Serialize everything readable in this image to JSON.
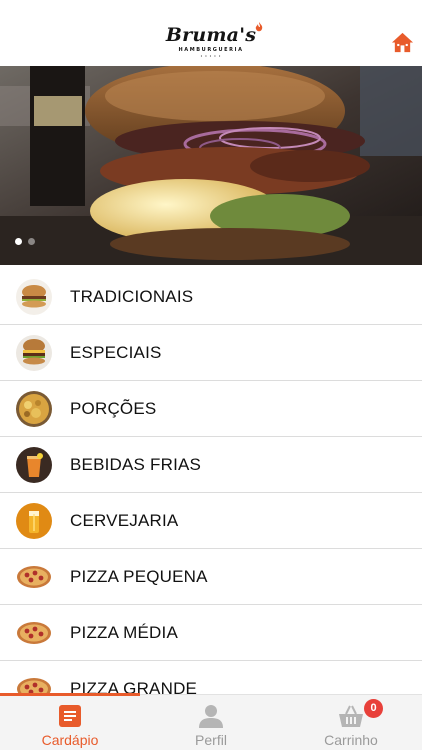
{
  "header": {
    "logo_main": "Bruma's",
    "logo_sub": "HAMBURGUERIA",
    "logo_dots": "• • • • •",
    "home_icon": "home-icon",
    "accent": "#e85b2b"
  },
  "banner": {
    "image": "burger-photo",
    "slides": 2,
    "active_slide": 1
  },
  "menu": {
    "items": [
      {
        "label": "TRADICIONAIS",
        "icon": "burger-thumb"
      },
      {
        "label": "ESPECIAIS",
        "icon": "special-burger-thumb"
      },
      {
        "label": "PORÇÕES",
        "icon": "portion-thumb"
      },
      {
        "label": "BEBIDAS FRIAS",
        "icon": "drink-thumb"
      },
      {
        "label": "CERVEJARIA",
        "icon": "beer-thumb"
      },
      {
        "label": "PIZZA PEQUENA",
        "icon": "pizza-thumb"
      },
      {
        "label": "PIZZA MÉDIA",
        "icon": "pizza-thumb"
      },
      {
        "label": "PIZZA GRANDE",
        "icon": "pizza-thumb"
      }
    ]
  },
  "tabbar": {
    "tabs": [
      {
        "label": "Cardápio",
        "icon": "menu-list-icon",
        "active": true
      },
      {
        "label": "Perfil",
        "icon": "user-icon",
        "active": false
      },
      {
        "label": "Carrinho",
        "icon": "basket-icon",
        "active": false,
        "badge": "0"
      }
    ],
    "active_color": "#e85b2b",
    "inactive_color": "#9a9a9a",
    "badge_color": "#e8403a"
  }
}
